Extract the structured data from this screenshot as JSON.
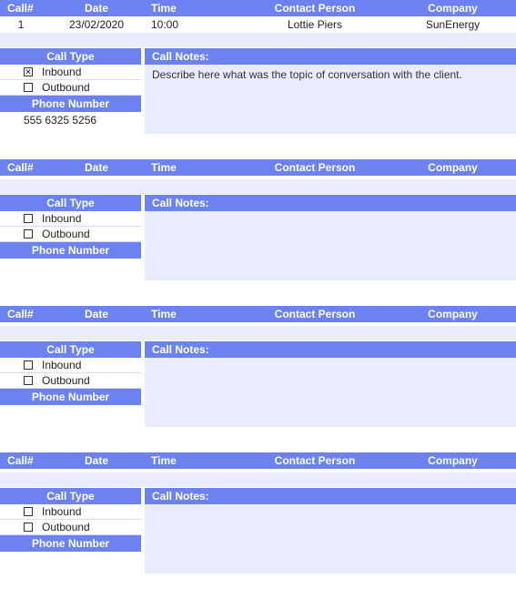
{
  "headers": {
    "call": "Call#",
    "date": "Date",
    "time": "Time",
    "contact": "Contact Person",
    "company": "Company",
    "callType": "Call Type",
    "callNotes": "Call Notes:",
    "phoneNumber": "Phone Number",
    "inbound": "Inbound",
    "outbound": "Outbound"
  },
  "records": [
    {
      "call": "1",
      "date": "23/02/2020",
      "time": "10:00",
      "contact": "Lottie Piers",
      "company": "SunEnergy",
      "inbound": true,
      "outbound": false,
      "phone": "555 6325 5256",
      "notes": "Describe here what was the topic of conversation with the client."
    },
    {
      "call": "",
      "date": "",
      "time": "",
      "contact": "",
      "company": "",
      "inbound": false,
      "outbound": false,
      "phone": "",
      "notes": ""
    },
    {
      "call": "",
      "date": "",
      "time": "",
      "contact": "",
      "company": "",
      "inbound": false,
      "outbound": false,
      "phone": "",
      "notes": ""
    },
    {
      "call": "",
      "date": "",
      "time": "",
      "contact": "",
      "company": "",
      "inbound": false,
      "outbound": false,
      "phone": "",
      "notes": ""
    }
  ]
}
